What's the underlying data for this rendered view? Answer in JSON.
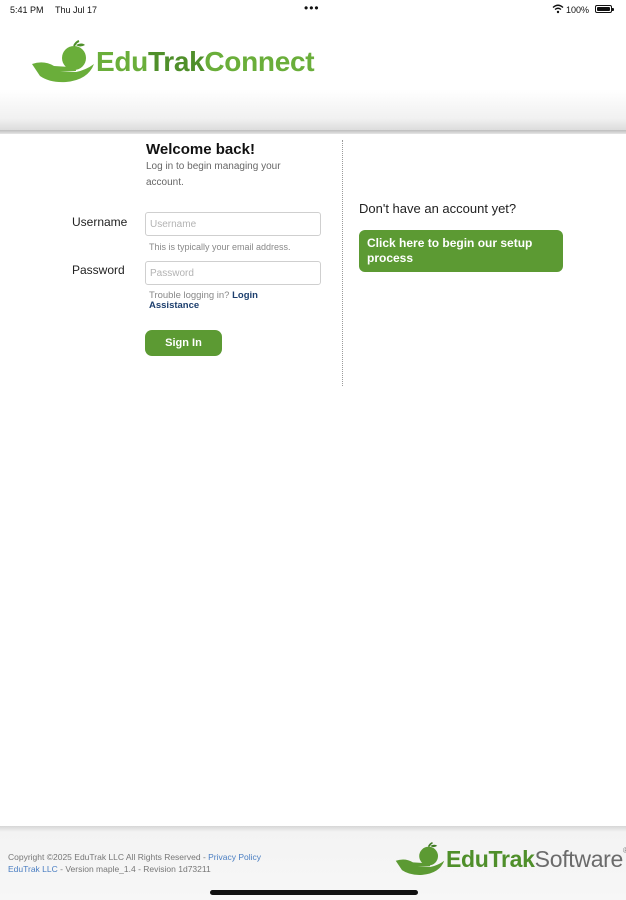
{
  "status_bar": {
    "time": "5:41 PM",
    "date": "Thu Jul 17",
    "dots": "•••",
    "battery": "100%"
  },
  "header": {
    "logo": {
      "part1": "Edu",
      "part2": "Trak",
      "part3": "Connect"
    }
  },
  "login": {
    "title": "Welcome back!",
    "subtitle": "Log in to begin managing your account.",
    "username_label": "Username",
    "username_placeholder": "Username",
    "username_value": "",
    "username_hint": "This is typically your email address.",
    "password_label": "Password",
    "password_placeholder": "Password",
    "password_value": "",
    "trouble_text": "Trouble logging in?",
    "trouble_link": "Login Assistance",
    "signin_label": "Sign In"
  },
  "signup": {
    "prompt": "Don't have an account yet?",
    "button_label": "Click here to begin our setup process"
  },
  "footer": {
    "copyright": "Copyright ©2025 EduTrak LLC All Rights Reserved",
    "sep1": " - ",
    "privacy_link": "Privacy Policy",
    "company_link": "EduTrak LLC",
    "version": " - Version maple_1.4 - Revision 1d73211",
    "logo": {
      "part1": "Edu",
      "part2": "Trak",
      "part3": "Software",
      "reg": "®"
    }
  },
  "colors": {
    "brand_green": "#6aae3a",
    "button_green": "#5c9a33",
    "link_blue": "#1d3f6e",
    "footer_link": "#4a7ec2"
  },
  "icons": [
    "wifi-icon",
    "battery-icon",
    "apple-hand-logo-icon"
  ]
}
